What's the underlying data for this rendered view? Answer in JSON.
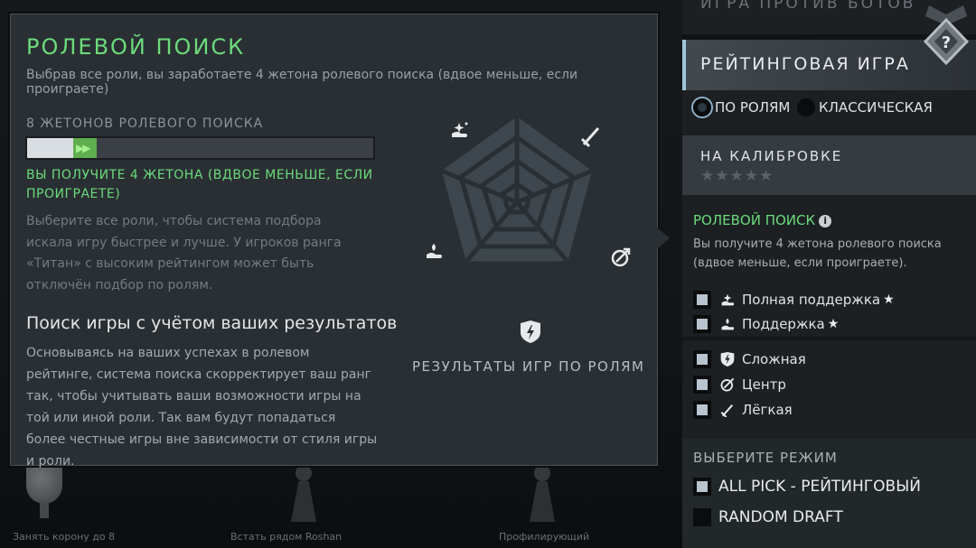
{
  "background": {
    "captions": [
      "Занять корону до 8",
      "Встать рядом Roshan",
      "Профилирующий"
    ]
  },
  "tooltip": {
    "title": "РОЛЕВОЙ ПОИСК",
    "subtitle": "Выбрав все роли, вы заработаете 4 жетона ролевого поиска (вдвое меньше, если проиграете)",
    "tokens_label": "8 ЖЕТОНОВ РОЛЕВОГО ПОИСКА",
    "token_progress": {
      "current": 8,
      "gain": 4,
      "max": 60
    },
    "gain_arrows": "▶▶",
    "gain_text": "ВЫ ПОЛУЧИТЕ 4 ЖЕТОНА (ВДВОЕ МЕНЬШЕ, ЕСЛИ ПРОИГРАЕТЕ)",
    "select_text": "Выберите все роли, чтобы система подбора искала игру быстрее и лучше. У игроков ранга «Титан» с высоким рейтингом может быть отключён подбор по ролям.",
    "search_heading": "Поиск игры с учётом ваших результатов",
    "search_body": "Основываясь на ваших успехах в ролевом рейтинге, система поиска скорректирует ваш ранг так, чтобы учитывать ваши возможности игры на той или иной роли. Так вам будут попадаться более честные игры вне зависимости от стиля игры и роли.",
    "radar_caption": "РЕЗУЛЬТАТЫ ИГР ПО РОЛЯМ",
    "radar_icons": [
      "hard-support-icon",
      "carry-icon",
      "mid-icon",
      "offlane-icon",
      "support-icon"
    ]
  },
  "right_panel": {
    "vs_bots": "ИГРА ПРОТИВ БОТОВ",
    "ranked_title": "РЕЙТИНГОВАЯ ИГРА",
    "radio": [
      {
        "label": "ПО РОЛЯМ",
        "selected": true
      },
      {
        "label": "КЛАССИЧЕСКАЯ",
        "selected": false
      }
    ],
    "calibration_title": "НА КАЛИБРОВКЕ",
    "calibration_stars": "★★★★★",
    "rank_badge_text": "?",
    "role_title": "РОЛЕВОЙ ПОИСК",
    "info_text": "i",
    "role_desc": "Вы получите 4 жетона ролевого поиска (вдвое меньше, если проиграете).",
    "roles": [
      {
        "label": "Полная поддержка",
        "icon": "hard-support-icon",
        "starred": true,
        "checked": true
      },
      {
        "label": "Поддержка",
        "icon": "support-icon",
        "starred": true,
        "checked": true
      },
      {
        "label": "Сложная",
        "icon": "offlane-icon",
        "starred": false,
        "checked": true
      },
      {
        "label": "Центр",
        "icon": "mid-icon",
        "starred": false,
        "checked": true
      },
      {
        "label": "Лёгкая",
        "icon": "carry-icon",
        "starred": false,
        "checked": true
      }
    ],
    "star": "★",
    "mode_title": "ВЫБЕРИТЕ РЕЖИМ",
    "modes": [
      {
        "label": "ALL PICK - РЕЙТИНГОВЫЙ",
        "checked": true
      },
      {
        "label": "RANDOM DRAFT",
        "checked": false
      }
    ]
  },
  "colors": {
    "accent_green": "#6bdb7c",
    "panel_dark": "#1c2023",
    "tooltip_bg": "#2a2f33",
    "radio_highlight": "#8fb3cc"
  }
}
